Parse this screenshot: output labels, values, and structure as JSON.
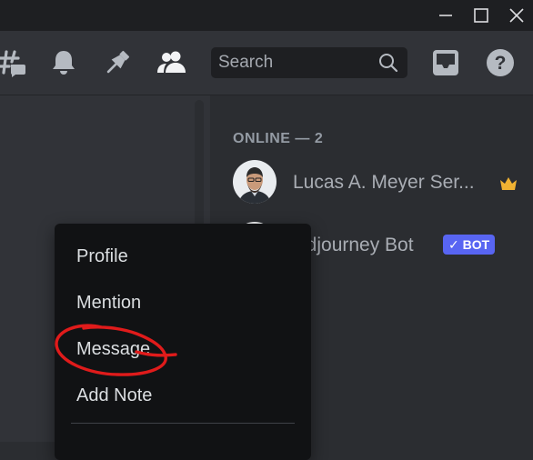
{
  "search": {
    "placeholder": "Search"
  },
  "toolbar": {
    "icons": [
      "threads-icon",
      "bell-icon",
      "pin-icon",
      "members-icon",
      "inbox-icon",
      "help-icon"
    ]
  },
  "window_controls": [
    "minimize-icon",
    "maximize-icon",
    "close-icon"
  ],
  "member_list": {
    "section_header": "ONLINE — 2",
    "members": [
      {
        "name": "Lucas A. Meyer Ser...",
        "badge_icon": "crown-icon"
      },
      {
        "name": "idjourney Bot",
        "tag": "BOT",
        "tag_icon": "checkmark-icon"
      }
    ]
  },
  "context_menu": {
    "items": [
      "Profile",
      "Mention",
      "Message",
      "Add Note"
    ]
  },
  "colors": {
    "accent": "#5865f2",
    "crown": "#f0b232",
    "annotation": "#e01b1b",
    "menu_bg": "#111214",
    "sidebar_bg": "#2b2d31"
  }
}
